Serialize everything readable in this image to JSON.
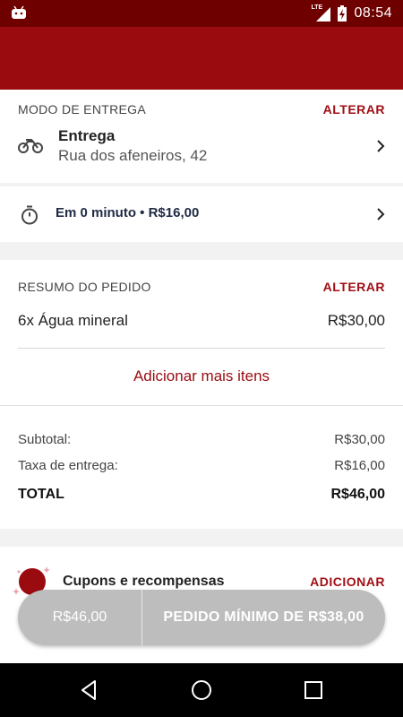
{
  "status_bar": {
    "time": "08:54",
    "network": "LTE"
  },
  "delivery": {
    "section_title": "MODO DE ENTREGA",
    "change_label": "ALTERAR",
    "mode": "Entrega",
    "address": "Rua dos afeneiros, 42",
    "time_and_fee": "Em 0 minuto • R$16,00"
  },
  "order": {
    "section_title": "RESUMO DO PEDIDO",
    "change_label": "ALTERAR",
    "items": [
      {
        "name": "6x Água mineral",
        "price": "R$30,00"
      }
    ],
    "add_more_label": "Adicionar mais itens"
  },
  "totals": {
    "subtotal_label": "Subtotal:",
    "subtotal_value": "R$30,00",
    "delivery_fee_label": "Taxa de entrega:",
    "delivery_fee_value": "R$16,00",
    "total_label": "TOTAL",
    "total_value": "R$46,00"
  },
  "coupons": {
    "label": "Cupons e recompensas",
    "action_label": "ADICIONAR"
  },
  "checkout_bar": {
    "amount": "R$46,00",
    "message": "PEDIDO MÍNIMO DE R$38,00"
  },
  "colors": {
    "brand": "#9a0b10",
    "status_bar": "#6e0000",
    "accent_text": "#a10f16",
    "disabled_button": "#bdbdbd"
  }
}
